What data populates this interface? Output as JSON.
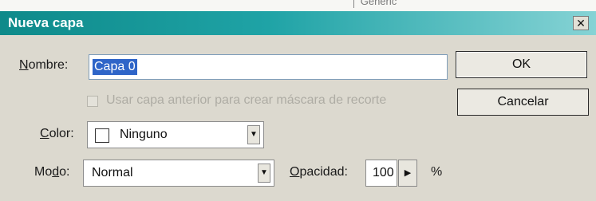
{
  "background_strip": {
    "text": "│ Genéric"
  },
  "dialog": {
    "title": "Nueva capa",
    "close_icon": "close-icon"
  },
  "name_field": {
    "label_prefix": "N",
    "label_rest": "ombre:",
    "value": "Capa 0"
  },
  "clipping_mask": {
    "label": "Usar capa anterior para crear máscara de recorte",
    "checked": false,
    "enabled": false
  },
  "color": {
    "label_prefix": "C",
    "label_rest": "olor:",
    "value": "Ninguno"
  },
  "mode": {
    "label_prefix": "Mo",
    "label_mid": "d",
    "label_rest": "o:",
    "value": "Normal"
  },
  "opacity": {
    "label_prefix": "O",
    "label_rest": "pacidad:",
    "value": "100",
    "unit": "%"
  },
  "buttons": {
    "ok": "OK",
    "cancel": "Cancelar"
  },
  "colors": {
    "title_bar_start": "#0e8a8a",
    "title_bar_end": "#86d3d5",
    "dialog_bg": "#dcd9cf",
    "selection": "#2f65c8"
  }
}
